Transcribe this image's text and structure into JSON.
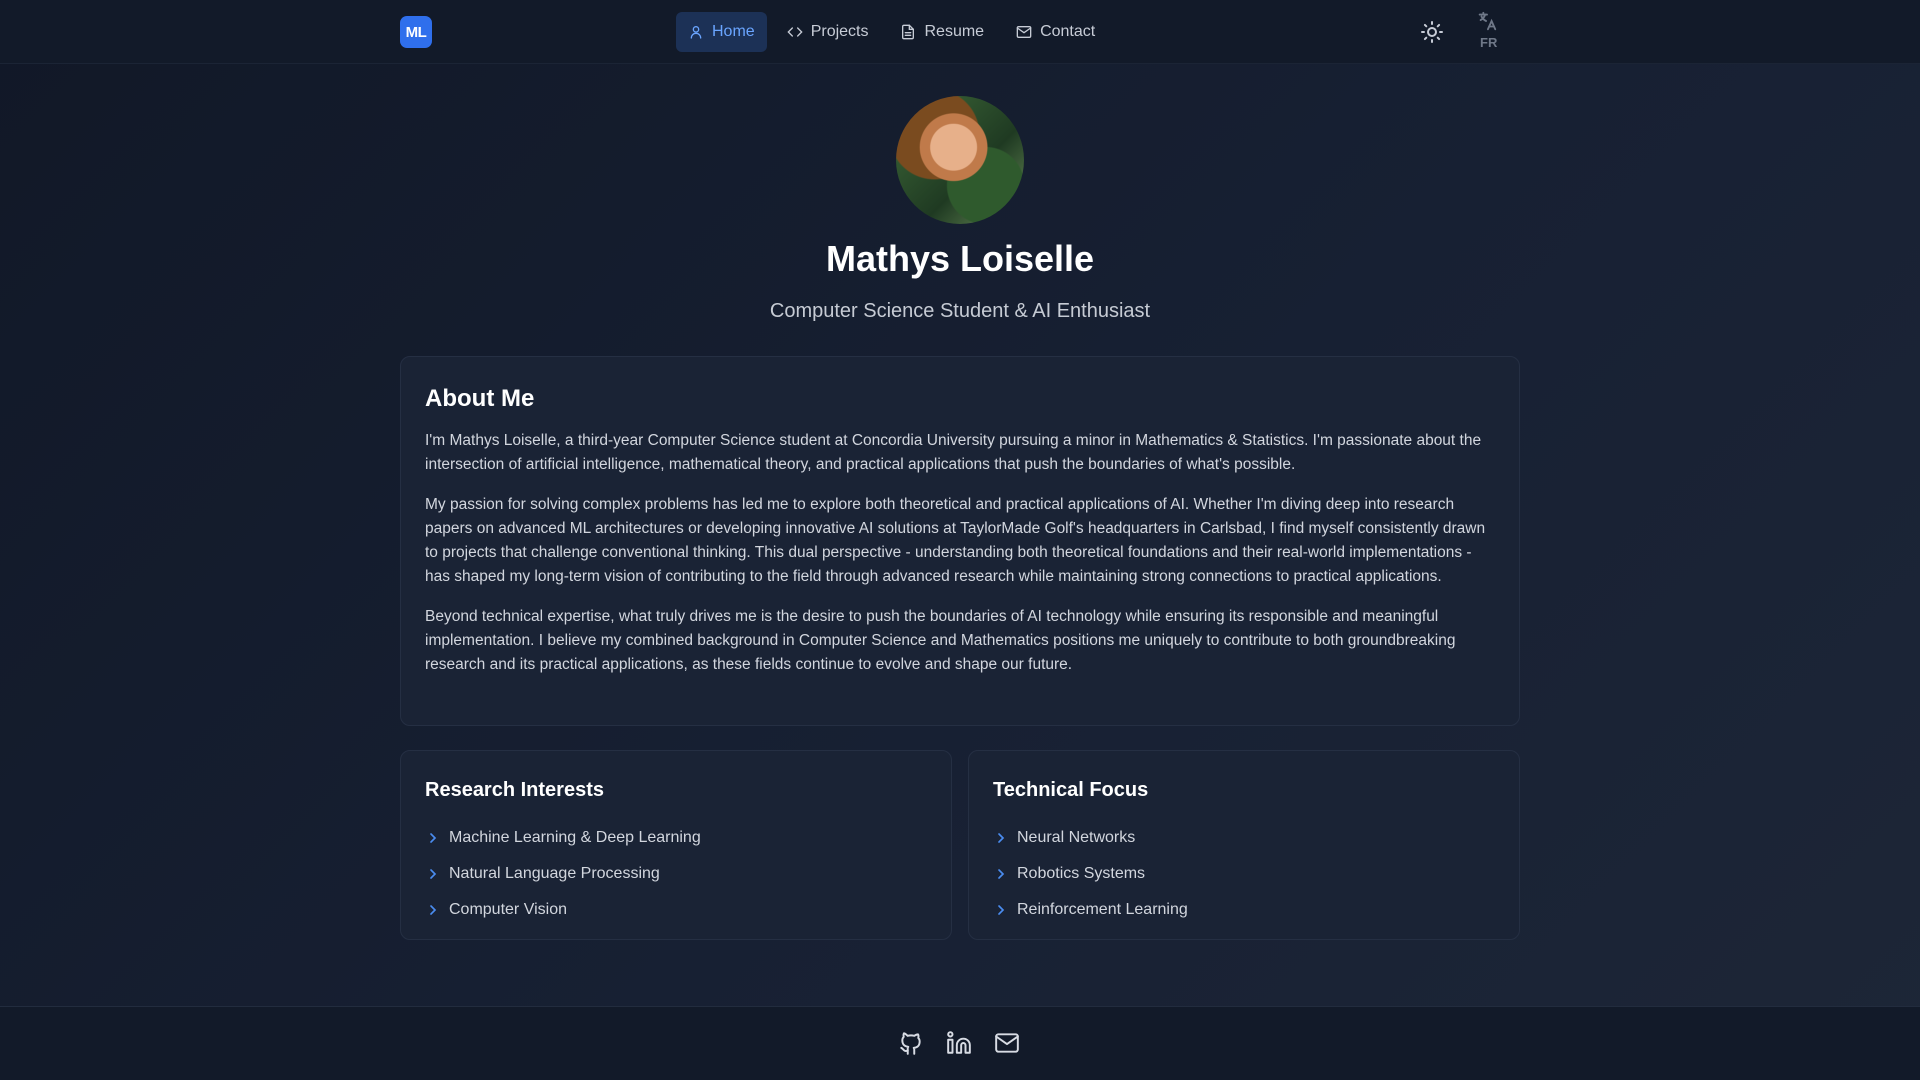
{
  "brand": {
    "logo_text": "ML"
  },
  "nav": {
    "items": [
      {
        "label": "Home",
        "icon": "user-icon",
        "active": true
      },
      {
        "label": "Projects",
        "icon": "code-icon",
        "active": false
      },
      {
        "label": "Resume",
        "icon": "file-icon",
        "active": false
      },
      {
        "label": "Contact",
        "icon": "mail-icon",
        "active": false
      }
    ],
    "theme_icon": "sun-icon",
    "language_icon": "translate-icon",
    "language_label": "FR"
  },
  "hero": {
    "name": "Mathys Loiselle",
    "tagline": "Computer Science Student & AI Enthusiast"
  },
  "about": {
    "title": "About Me",
    "paragraphs": [
      "I'm Mathys Loiselle, a third-year Computer Science student at Concordia University pursuing a minor in Mathematics & Statistics. I'm passionate about the intersection of artificial intelligence, mathematical theory, and practical applications that push the boundaries of what's possible.",
      "My passion for solving complex problems has led me to explore both theoretical and practical applications of AI. Whether I'm diving deep into research papers on advanced ML architectures or developing innovative AI solutions at TaylorMade Golf's headquarters in Carlsbad, I find myself consistently drawn to projects that challenge conventional thinking. This dual perspective - understanding both theoretical foundations and their real-world implementations - has shaped my long-term vision of contributing to the field through advanced research while maintaining strong connections to practical applications.",
      "Beyond technical expertise, what truly drives me is the desire to push the boundaries of AI technology while ensuring its responsible and meaningful implementation. I believe my combined background in Computer Science and Mathematics positions me uniquely to contribute to both groundbreaking research and its practical applications, as these fields continue to evolve and shape our future."
    ]
  },
  "research": {
    "title": "Research Interests",
    "items": [
      "Machine Learning & Deep Learning",
      "Natural Language Processing",
      "Computer Vision"
    ]
  },
  "focus": {
    "title": "Technical Focus",
    "items": [
      "Neural Networks",
      "Robotics Systems",
      "Reinforcement Learning"
    ]
  },
  "footer": {
    "icons": [
      "github-icon",
      "linkedin-icon",
      "mail-icon"
    ]
  },
  "colors": {
    "accent": "#2f6fec",
    "active_nav_bg": "#1c3156",
    "active_nav_text": "#6aa5ff",
    "bullet": "#4a8cf0",
    "background": "#141c2c",
    "card": "#1a2335"
  }
}
